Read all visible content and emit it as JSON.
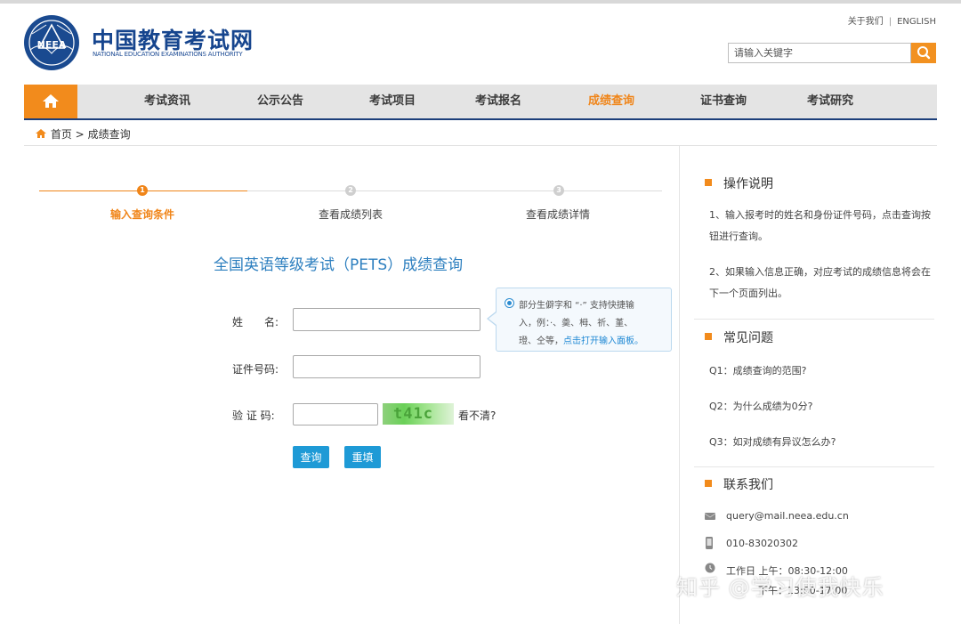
{
  "header": {
    "logo_cn": "中国教育考试网",
    "logo_en": "NATIONAL EDUCATION EXAMINATIONS AUTHORITY",
    "logo_mark": "NEEA",
    "links": {
      "about": "关于我们",
      "sep": "|",
      "english": "ENGLISH"
    },
    "search": {
      "placeholder": "请输入关键字"
    }
  },
  "nav": {
    "items": [
      "考试资讯",
      "公示公告",
      "考试项目",
      "考试报名",
      "成绩查询",
      "证书查询",
      "考试研究"
    ],
    "active": "成绩查询"
  },
  "breadcrumb": {
    "home": "首页",
    "sep": ">",
    "current": "成绩查询"
  },
  "steps": [
    {
      "num": "1",
      "label": "输入查询条件",
      "active": true
    },
    {
      "num": "2",
      "label": "查看成绩列表",
      "active": false
    },
    {
      "num": "3",
      "label": "查看成绩详情",
      "active": false
    }
  ],
  "form": {
    "title": "全国英语等级考试（PETS）成绩查询",
    "name_label": "姓　　名:",
    "id_label": "证件号码:",
    "captcha_label": "验 证 码:",
    "captcha_text": "t41c",
    "refresh": "看不清?",
    "submit": "查询",
    "reset": "重填"
  },
  "tip": {
    "line1": "部分生僻字和 “·” 支持快捷输",
    "line2": "入，例：·、羮、栂、祈、堇、",
    "line3_a": "璒、仝等，",
    "line3_link": "点击打开输入面板。"
  },
  "side": {
    "instructions": {
      "title": "操作说明",
      "p1": "1、输入报考时的姓名和身份证件号码，点击查询按钮进行查询。",
      "p2": "2、如果输入信息正确，对应考试的成绩信息将会在下一个页面列出。"
    },
    "faq": {
      "title": "常见问题",
      "items": [
        "Q1：成绩查询的范围?",
        "Q2：为什么成绩为0分?",
        "Q3：如对成绩有异议怎么办?"
      ]
    },
    "contact": {
      "title": "联系我们",
      "email": "query@mail.neea.edu.cn",
      "phone": "010-83020302",
      "hours1": "工作日 上午：08:30-12:00",
      "hours2": "下午：13:00-17:00"
    }
  },
  "watermark": "知乎 @学习使我快乐",
  "colors": {
    "brand_blue": "#16458e",
    "accent_orange": "#f28b1c",
    "button_blue": "#1e9ad6",
    "title_blue": "#2d7fbf"
  }
}
